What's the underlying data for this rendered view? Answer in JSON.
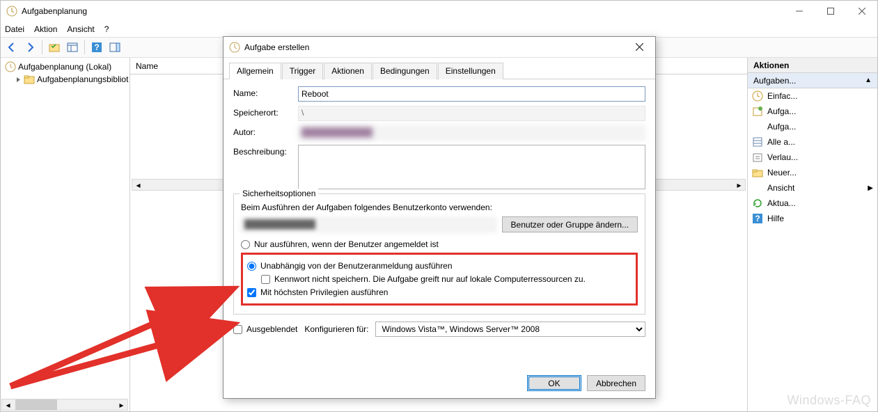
{
  "window": {
    "title": "Aufgabenplanung"
  },
  "menu": {
    "file": "Datei",
    "action": "Aktion",
    "view": "Ansicht",
    "help": "?"
  },
  "tree": {
    "root": "Aufgabenplanung (Lokal)",
    "child": "Aufgabenplanungsbibliot"
  },
  "list": {
    "col_name": "Name"
  },
  "actions": {
    "header": "Aktionen",
    "subheader": "Aufgaben...",
    "items": [
      "Einfac...",
      "Aufga...",
      "Aufga...",
      "Alle a...",
      "Verlau...",
      "Neuer...",
      "Ansicht",
      "Aktua...",
      "Hilfe"
    ]
  },
  "dialog": {
    "title": "Aufgabe erstellen",
    "tabs": {
      "general": "Allgemein",
      "trigger": "Trigger",
      "actions": "Aktionen",
      "conditions": "Bedingungen",
      "settings": "Einstellungen"
    },
    "labels": {
      "name": "Name:",
      "location": "Speicherort:",
      "author": "Autor:",
      "description": "Beschreibung:"
    },
    "values": {
      "name": "Reboot",
      "location": "\\",
      "author": "████████████"
    },
    "security": {
      "group_title": "Sicherheitsoptionen",
      "account_hint": "Beim Ausführen der Aufgaben folgendes Benutzerkonto verwenden:",
      "account": "████████████",
      "change_btn": "Benutzer oder Gruppe ändern...",
      "radio_logged": "Nur ausführen, wenn der Benutzer angemeldet ist",
      "radio_any": "Unabhängig von der Benutzeranmeldung ausführen",
      "check_nopass": "Kennwort nicht speichern. Die Aufgabe greift nur auf lokale Computerressourcen zu.",
      "check_priv": "Mit höchsten Privilegien ausführen"
    },
    "hidden_label": "Ausgeblendet",
    "configure_label": "Konfigurieren für:",
    "configure_value": "Windows Vista™, Windows Server™ 2008",
    "ok": "OK",
    "cancel": "Abbrechen"
  },
  "watermark": "Windows-FAQ"
}
